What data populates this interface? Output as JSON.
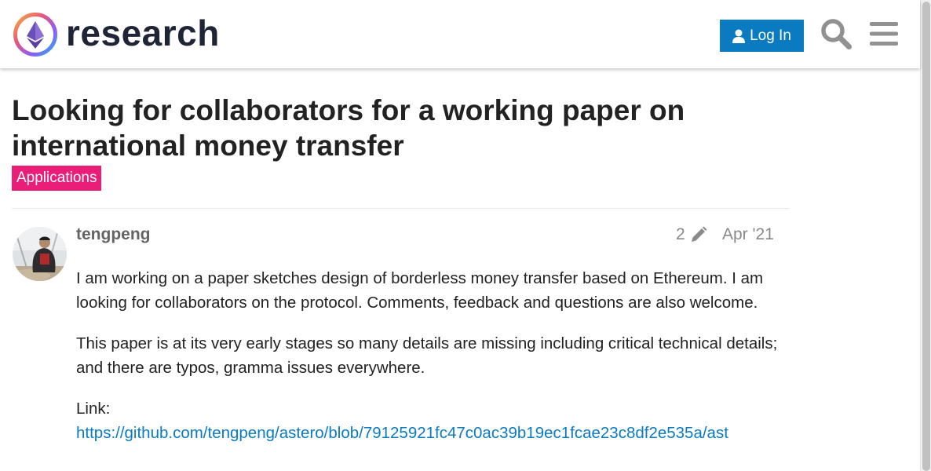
{
  "header": {
    "site_name": "research",
    "login_label": "Log In",
    "icons": {
      "logo": "ethereum-research-logo",
      "user": "user-icon",
      "search": "search-icon",
      "menu": "hamburger-menu-icon"
    },
    "colors": {
      "login_bg": "#0a7bc1",
      "site_name": "#1f2536"
    }
  },
  "topic": {
    "title": "Looking for collaborators for a working paper on international money transfer",
    "category": "Applications",
    "category_color": "#e91e79"
  },
  "post": {
    "username": "tengpeng",
    "edit_count": "2",
    "edit_icon": "pencil-icon",
    "date": "Apr '21",
    "avatar": "user-avatar-photo",
    "paragraph_1": "I am working on a paper sketches design of borderless money transfer based on Ethereum. I am looking for collaborators on the protocol. Comments, feedback and questions are also welcome.",
    "paragraph_2": "This paper is at its very early stages so many details are missing including critical technical details; and there are typos, gramma issues everywhere.",
    "link_label": "Link:",
    "link_url": "https://github.com/tengpeng/astero/blob/79125921fc47c0ac39b19ec1fcae23c8df2e535a/ast"
  }
}
